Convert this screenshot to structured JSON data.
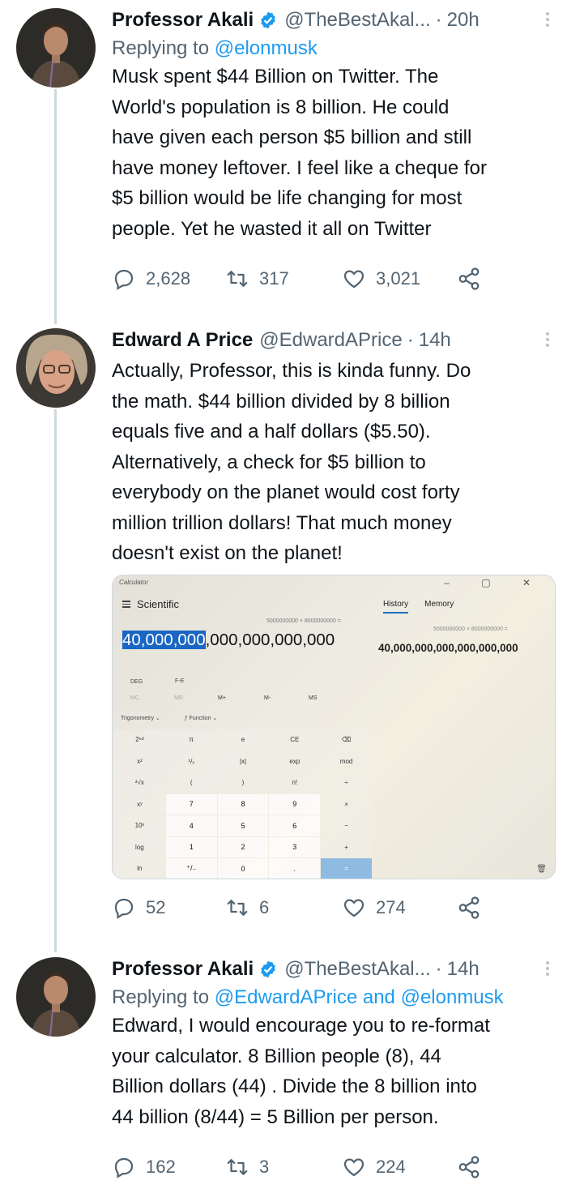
{
  "tweets": [
    {
      "name": "Professor Akali",
      "handle": "@TheBestAkal...",
      "time": "20h",
      "replying_prefix": "Replying to",
      "replying_to": "@elonmusk",
      "replying_and": "",
      "replying_to2": "",
      "text": "Musk spent $44 Billion on Twitter.   The\nWorld's population is 8 billion.   He could\nhave given each person $5 billion and still\nhave money leftover.  I feel like a cheque for\n$5 billion would be life changing for most\npeople. Yet he wasted it all on Twitter",
      "replies": "2,628",
      "retweets": "317",
      "likes": "3,021"
    },
    {
      "name": "Edward A Price",
      "handle": "@EdwardAPrice",
      "time": "14h",
      "text": "Actually, Professor, this is kinda funny. Do\nthe math. $44 billion divided by 8 billion\nequals five and a half dollars ($5.50).\nAlternatively, a check for $5 billion to\neverybody on the planet would cost forty\nmillion trillion dollars! That much money\ndoesn't exist on the planet!",
      "replies": "52",
      "retweets": "6",
      "likes": "274"
    },
    {
      "name": "Professor Akali",
      "handle": "@TheBestAkal...",
      "time": "14h",
      "replying_prefix": "Replying to",
      "replying_to": "@EdwardAPrice",
      "replying_and": "and",
      "replying_to2": "@elonmusk",
      "text": "Edward, I would encourage you to re-format\nyour calculator.  8 Billion people (8), 44\nBillion dollars (44) .  Divide the 8 billion into\n44 billion (8/44) = 5 Billion per person.",
      "replies": "162",
      "retweets": "3",
      "likes": "224"
    }
  ],
  "calculator": {
    "title": "Calculator",
    "window_controls": "–  ▢  ✕",
    "mode": "Scientific",
    "tab_history": "History",
    "tab_memory": "Memory",
    "expression": "5000000000 × 8000000000 =",
    "history_expression": "5000000000 × 8000000000 =",
    "result_selected": "40,000,000",
    "result_rest": ",000,000,000,000",
    "history_result": "40,000,000,000,000,000,000",
    "deg": "DEG",
    "fe": "F-E",
    "memory_keys": [
      "MC",
      "MR",
      "M+",
      "M-",
      "MS"
    ],
    "trig": "Trigonometry ⌄",
    "function": "ƒ  Function ⌄",
    "keys": [
      "2ⁿᵈ",
      "π",
      "e",
      "CE",
      "⌫",
      "x²",
      "¹/ₓ",
      "|x|",
      "exp",
      "mod",
      "²√x",
      "(",
      ")",
      "n!",
      "÷",
      "xʸ",
      "7",
      "8",
      "9",
      "×",
      "10ˣ",
      "4",
      "5",
      "6",
      "−",
      "log",
      "1",
      "2",
      "3",
      "+",
      "ln",
      "⁺/₋",
      "0",
      ".",
      "="
    ],
    "trash": "🗑"
  },
  "icons": {
    "reply": "reply-icon",
    "retweet": "retweet-icon",
    "like": "heart-icon",
    "share": "share-icon",
    "verified": "verified-badge-icon"
  },
  "colors": {
    "link": "#1d9bf0",
    "muted": "#536471",
    "thread_line": "#cfd9de",
    "selection": "#1966c4"
  }
}
